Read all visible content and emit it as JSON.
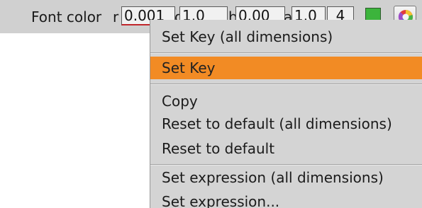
{
  "param": {
    "label": "Font color",
    "channels": [
      {
        "name": "r",
        "value": "0.001",
        "active": true
      },
      {
        "name": "g",
        "value": "1.0"
      },
      {
        "name": "b",
        "value": "0.00"
      },
      {
        "name": "a",
        "value": "1.0"
      }
    ],
    "dimensions": "4",
    "swatch_color": "#3cb43c",
    "picker_icon": "color-wheel-icon"
  },
  "context_menu": {
    "items": [
      {
        "label": "Set Key (all dimensions)"
      },
      {
        "label": "Set Key",
        "highlighted": true
      },
      {
        "label": "Copy"
      },
      {
        "label": "Reset to default (all dimensions)"
      },
      {
        "label": "Reset to default"
      },
      {
        "label": "Set expression (all dimensions)"
      },
      {
        "label": "Set expression..."
      }
    ],
    "highlight_color": "#f28b24"
  }
}
